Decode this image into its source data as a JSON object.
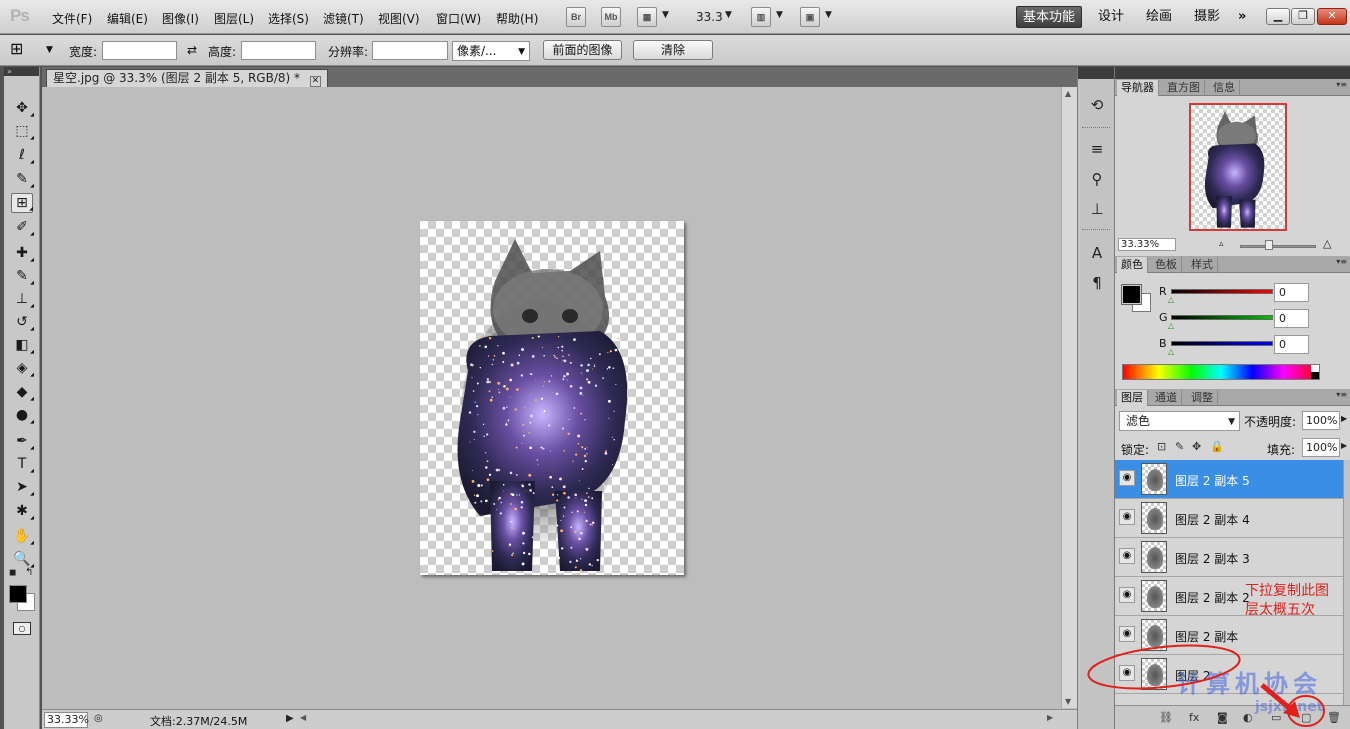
{
  "app": {
    "logo": "Ps",
    "menu": [
      "文件(F)",
      "编辑(E)",
      "图像(I)",
      "图层(L)",
      "选择(S)",
      "滤镜(T)",
      "视图(V)",
      "窗口(W)",
      "帮助(H)"
    ],
    "br_label": "Br",
    "mb_label": "Mb",
    "zoom_value": "33.3",
    "workspaces": [
      "基本功能",
      "设计",
      "绘画",
      "摄影"
    ],
    "more": "»",
    "win_min": "▁",
    "win_restore": "❐",
    "win_close": "✕"
  },
  "options": {
    "width_label": "宽度:",
    "height_label": "高度:",
    "resolution_label": "分辨率:",
    "unit": "像素/...",
    "front_image_btn": "前面的图像",
    "clear_btn": "清除",
    "swap_icon": "⇄",
    "crop_icon": "⊞"
  },
  "document": {
    "tab_title": "星空.jpg @ 33.3% (图层 2 副本 5, RGB/8) *",
    "zoom": "33.33%",
    "doc_info": "文档:2.37M/24.5M"
  },
  "tools": [
    {
      "name": "move-tool-icon",
      "glyph": "✥"
    },
    {
      "name": "marquee-tool-icon",
      "glyph": "⬚"
    },
    {
      "name": "lasso-tool-icon",
      "glyph": "ℓ"
    },
    {
      "name": "quick-select-tool-icon",
      "glyph": "✎"
    },
    {
      "name": "crop-tool-icon",
      "glyph": "⊞"
    },
    {
      "name": "eyedropper-tool-icon",
      "glyph": "✐"
    },
    {
      "name": "healing-brush-tool-icon",
      "glyph": "✚"
    },
    {
      "name": "brush-tool-icon",
      "glyph": "✎"
    },
    {
      "name": "clone-stamp-tool-icon",
      "glyph": "⊥"
    },
    {
      "name": "history-brush-tool-icon",
      "glyph": "↺"
    },
    {
      "name": "eraser-tool-icon",
      "glyph": "◧"
    },
    {
      "name": "paint-bucket-tool-icon",
      "glyph": "◈"
    },
    {
      "name": "blur-tool-icon",
      "glyph": "◆"
    },
    {
      "name": "dodge-tool-icon",
      "glyph": "●"
    },
    {
      "name": "pen-tool-icon",
      "glyph": "✒"
    },
    {
      "name": "type-tool-icon",
      "glyph": "T"
    },
    {
      "name": "path-select-tool-icon",
      "glyph": "➤"
    },
    {
      "name": "shape-tool-icon",
      "glyph": "✱"
    },
    {
      "name": "hand-tool-icon",
      "glyph": "✋"
    },
    {
      "name": "zoom-tool-icon",
      "glyph": "🔍"
    }
  ],
  "navigator": {
    "tabs": [
      "导航器",
      "直方图",
      "信息"
    ],
    "zoom": "33.33%"
  },
  "color": {
    "tabs": [
      "颜色",
      "色板",
      "样式"
    ],
    "r_label": "R",
    "g_label": "G",
    "b_label": "B",
    "r": "0",
    "g": "0",
    "b": "0"
  },
  "layers": {
    "tabs": [
      "图层",
      "通道",
      "调整"
    ],
    "blend_mode": "滤色",
    "opacity_label": "不透明度:",
    "opacity": "100%",
    "lock_label": "锁定:",
    "fill_label": "填充:",
    "fill": "100%",
    "items": [
      {
        "name": "图层 2 副本 5",
        "selected": true
      },
      {
        "name": "图层 2 副本 4",
        "selected": false
      },
      {
        "name": "图层 2 副本 3",
        "selected": false
      },
      {
        "name": "图层 2 副本 2",
        "selected": false
      },
      {
        "name": "图层 2 副本",
        "selected": false
      },
      {
        "name": "图层 2",
        "selected": false
      }
    ]
  },
  "annotation": {
    "line1": "下拉复制此图",
    "line2": "层太概五次",
    "watermark": "计算机协会",
    "watermark_url": "jsjxh.net"
  },
  "colors": {
    "accent": "#3b8ee6",
    "annotation": "#e0201b"
  }
}
